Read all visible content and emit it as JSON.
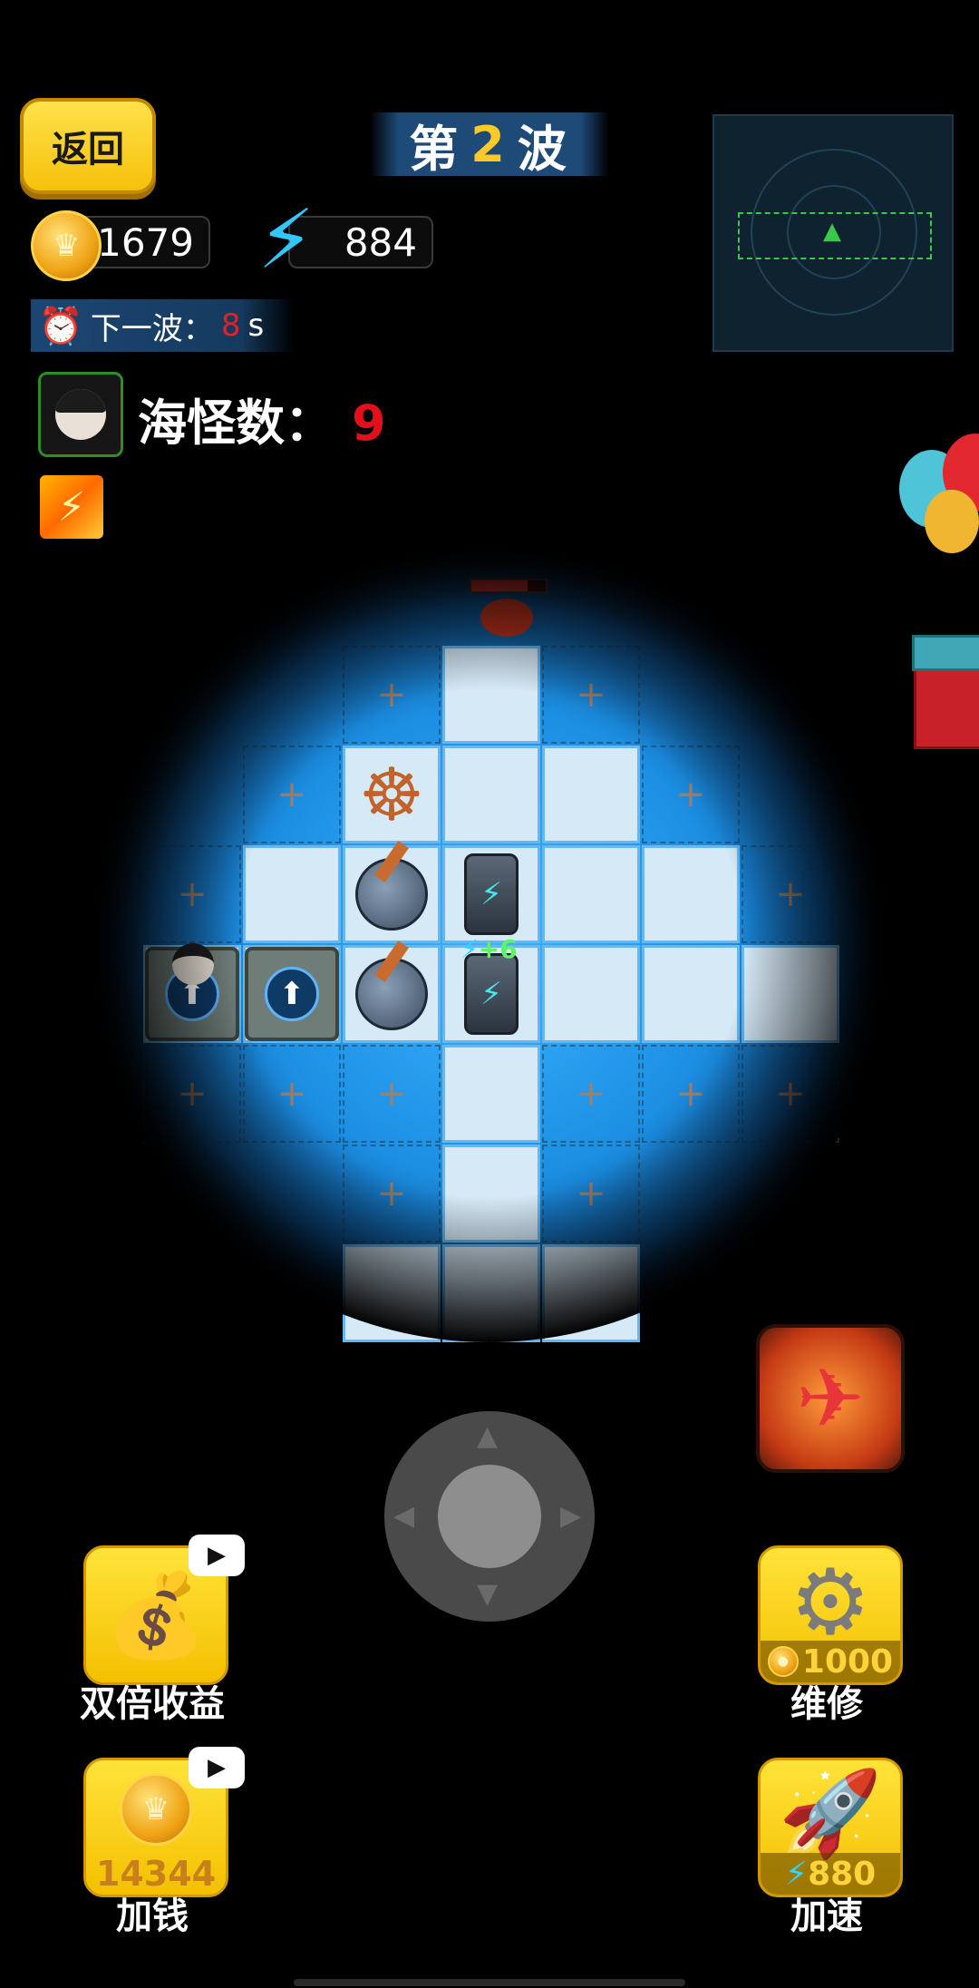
{
  "header": {
    "back_label": "返回",
    "wave_prefix": "第",
    "wave_number": "2",
    "wave_suffix": "波"
  },
  "resources": {
    "coins": "1679",
    "energy": "884"
  },
  "timer": {
    "label": "下一波：",
    "seconds": "8",
    "unit": "s"
  },
  "monsters": {
    "label": "海怪数：",
    "count": "9"
  },
  "map": {
    "energy_gain": "+6"
  },
  "actions": {
    "double_income_label": "双倍收益",
    "add_money_amount": "14344",
    "add_money_label": "加钱",
    "repair_cost": "1000",
    "repair_label": "维修",
    "speedup_cost": "880",
    "speedup_label": "加速"
  },
  "icons": {
    "back": "back-button",
    "coin": "coin-icon",
    "energy": "lightning-icon",
    "clock": "alarm-clock-icon",
    "video": "video-ad-icon",
    "gear": "gear-icon",
    "rocket": "rocket-icon",
    "bag": "money-bag-icon",
    "fighter": "fighter-jet-icon"
  },
  "colors": {
    "accent_yellow": "#ffc928",
    "timer_red": "#e0212b",
    "monster_count_red": "#e3101a",
    "ice": "#d6e9f7",
    "water": "#1c8fe3"
  }
}
